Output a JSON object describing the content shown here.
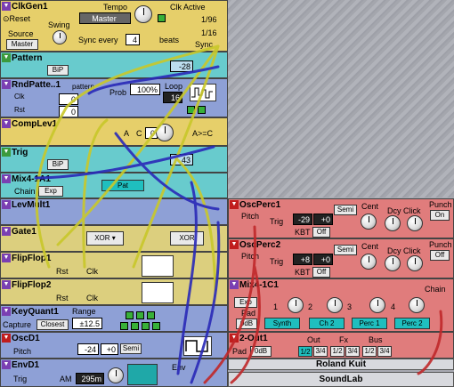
{
  "clk": {
    "title": "ClkGen1",
    "reset": "Reset",
    "tempo_lbl": "Tempo",
    "tempo": "Master",
    "clk_active": "Clk Active",
    "swing": "Swing",
    "source_lbl": "Source",
    "source": "Master",
    "div1": "1/96",
    "div2": "1/16",
    "sync_every": "Sync every",
    "sync_val": "4",
    "beats": "beats",
    "sync": "Sync"
  },
  "pattern": {
    "title": "Pattern",
    "bip": "BiP",
    "val": "-28"
  },
  "rnd": {
    "title": "RndPatte..1",
    "pattern": "pattern",
    "clk": "Clk",
    "rst": "Rst",
    "v1": "0",
    "v2": "0",
    "prob_lbl": "Prob",
    "prob": "100%",
    "loop_lbl": "Loop",
    "loop": "16"
  },
  "comp": {
    "title": "CompLev1",
    "a": "A",
    "c": "C",
    "c_val": "0",
    "agc": "A>=C"
  },
  "trig": {
    "title": "Trig",
    "bip": "BiP",
    "val": "43"
  },
  "mix": {
    "title": "Mix4-1A1",
    "chain": "Chain",
    "exp": "Exp",
    "pat": "Pat"
  },
  "levmult": {
    "title": "LevMult1"
  },
  "gate": {
    "title": "Gate1",
    "xor1": "XOR",
    "xor2": "XOR"
  },
  "ff1": {
    "title": "FlipFlop1",
    "rst": "Rst",
    "clk": "Clk"
  },
  "ff2": {
    "title": "FlipFlop2",
    "rst": "Rst",
    "clk": "Clk"
  },
  "kq": {
    "title": "KeyQuant1",
    "range_lbl": "Range",
    "range": "±12.5",
    "capture": "Capture",
    "closest": "Closest"
  },
  "osc": {
    "title": "OscD1",
    "pitch": "Pitch",
    "v1": "-24",
    "v2": "+0",
    "semi": "Semi"
  },
  "env": {
    "title": "EnvD1",
    "trig": "Trig",
    "am": "AM",
    "time": "295m",
    "env": "Env"
  },
  "perc1": {
    "title": "OscPerc1",
    "pitch": "Pitch",
    "trig": "Trig",
    "semi": "Semi",
    "cent": "Cent",
    "dcy": "Dcy",
    "click": "Click",
    "punch": "Punch",
    "v1": "-29",
    "v2": "+0",
    "kbt": "KBT",
    "off": "Off",
    "punch_val": "On"
  },
  "perc2": {
    "title": "OscPerc2",
    "pitch": "Pitch",
    "trig": "Trig",
    "semi": "Semi",
    "cent": "Cent",
    "dcy": "Dcy",
    "click": "Click",
    "punch": "Punch",
    "v1": "+8",
    "v2": "+0",
    "kbt": "KBT",
    "off": "Off",
    "punch_val": "Off"
  },
  "mix4": {
    "title": "Mix4-1C1",
    "exp": "Exp",
    "pad": "Pad",
    "pad_val": "0dB",
    "chain": "Chain",
    "n1": "1",
    "n2": "2",
    "n3": "3",
    "n4": "4",
    "ch1": "Synth",
    "ch2": "Ch 2",
    "ch3": "Perc 1",
    "ch4": "Perc 2"
  },
  "out": {
    "title": "2-Out1",
    "pad": "Pad",
    "pad_val": "0dB",
    "out": "Out",
    "fx": "Fx",
    "bus": "Bus",
    "o1": "1/2",
    "o2": "3/4",
    "f1": "1/2",
    "f2": "3/4",
    "b1": "1/2",
    "b2": "3/4"
  },
  "footer": {
    "line1": "Roland Kuit",
    "line2": "SoundLab"
  },
  "colors": {
    "yellow": "#e6cf6a",
    "teal": "#68cbcd",
    "lavender": "#8ea0d6",
    "red": "#e07c7c",
    "cable_yellow": "#c9c82a",
    "cable_blue": "#2a2ab8",
    "cable_red": "#c0282a"
  }
}
